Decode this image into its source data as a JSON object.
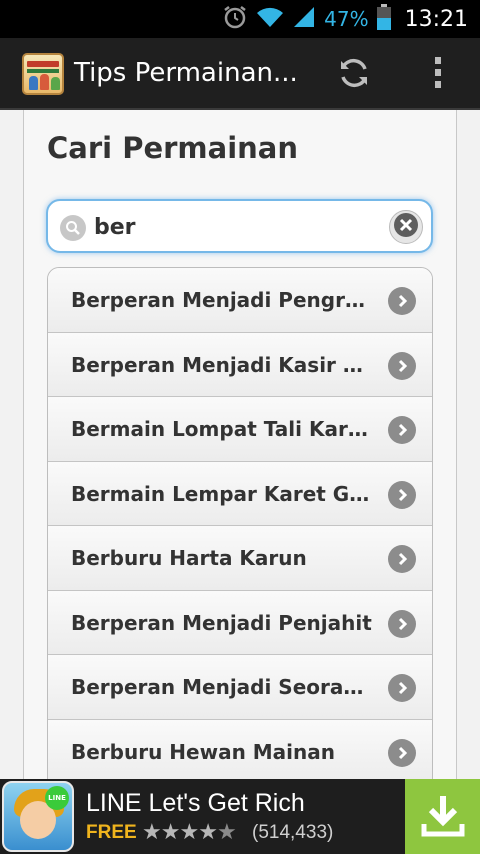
{
  "status_bar": {
    "battery_percent": "47%",
    "time": "13:21",
    "icons": [
      "alarm-icon",
      "wifi-icon",
      "signal-icon",
      "battery-icon"
    ]
  },
  "action_bar": {
    "title": "Tips Permainan...",
    "icons": [
      "app-logo-icon",
      "refresh-icon",
      "overflow-menu-icon"
    ]
  },
  "page": {
    "title": "Cari Permainan"
  },
  "search": {
    "value": "ber"
  },
  "results": [
    {
      "label": "Berperan Menjadi Pengraji..."
    },
    {
      "label": "Berperan Menjadi Kasir Ba..."
    },
    {
      "label": "Bermain Lompat Tali Kare..."
    },
    {
      "label": "Bermain Lempar Karet Gel..."
    },
    {
      "label": "Berburu Harta Karun"
    },
    {
      "label": "Berperan Menjadi Penjahit"
    },
    {
      "label": "Berperan Menjadi Seorang..."
    },
    {
      "label": "Berburu Hewan Mainan"
    }
  ],
  "ad": {
    "title": "LINE Let's Get Rich",
    "price": "FREE",
    "rating_stars": 4.5,
    "rating_count": "(514,433)",
    "badge_text": "LINE",
    "accent_color": "#8ec63f"
  },
  "colors": {
    "status_text": "#33b5e5",
    "action_bar": "#1f1f1f",
    "search_focus": "#75b8e8"
  }
}
